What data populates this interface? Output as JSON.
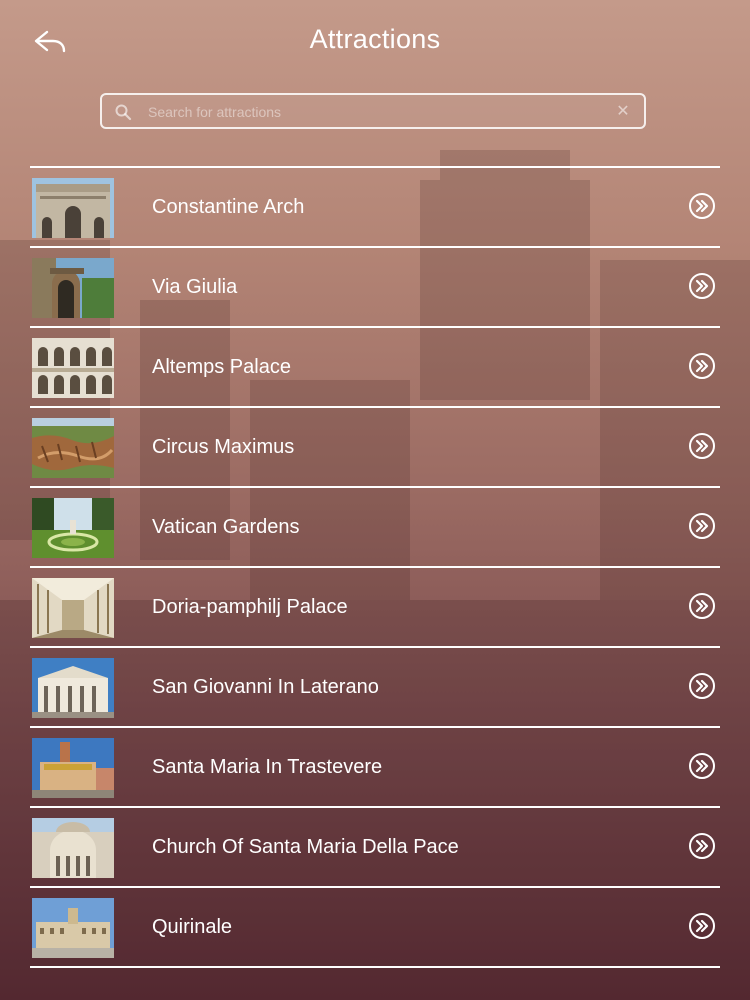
{
  "header": {
    "title": "Attractions",
    "back_icon": "back-arrow-icon"
  },
  "search": {
    "placeholder": "Search for attractions",
    "value": "",
    "icon": "search-icon",
    "clear_icon": "clear-icon"
  },
  "attractions": [
    {
      "name": "Constantine Arch",
      "thumb": "arch"
    },
    {
      "name": "Via Giulia",
      "thumb": "street"
    },
    {
      "name": "Altemps Palace",
      "thumb": "arcade"
    },
    {
      "name": "Circus Maximus",
      "thumb": "ruins"
    },
    {
      "name": "Vatican Gardens",
      "thumb": "garden"
    },
    {
      "name": "Doria-pamphilj Palace",
      "thumb": "gallery"
    },
    {
      "name": "San Giovanni In Laterano",
      "thumb": "facade"
    },
    {
      "name": "Santa Maria In Trastevere",
      "thumb": "piazza"
    },
    {
      "name": "Church Of Santa Maria Della Pace",
      "thumb": "church"
    },
    {
      "name": "Quirinale",
      "thumb": "palace"
    }
  ],
  "row_action_icon": "double-chevron-right-icon",
  "colors": {
    "text": "#ffffff",
    "bg_top": "#c49a8a",
    "bg_bottom": "#5d2e37"
  }
}
